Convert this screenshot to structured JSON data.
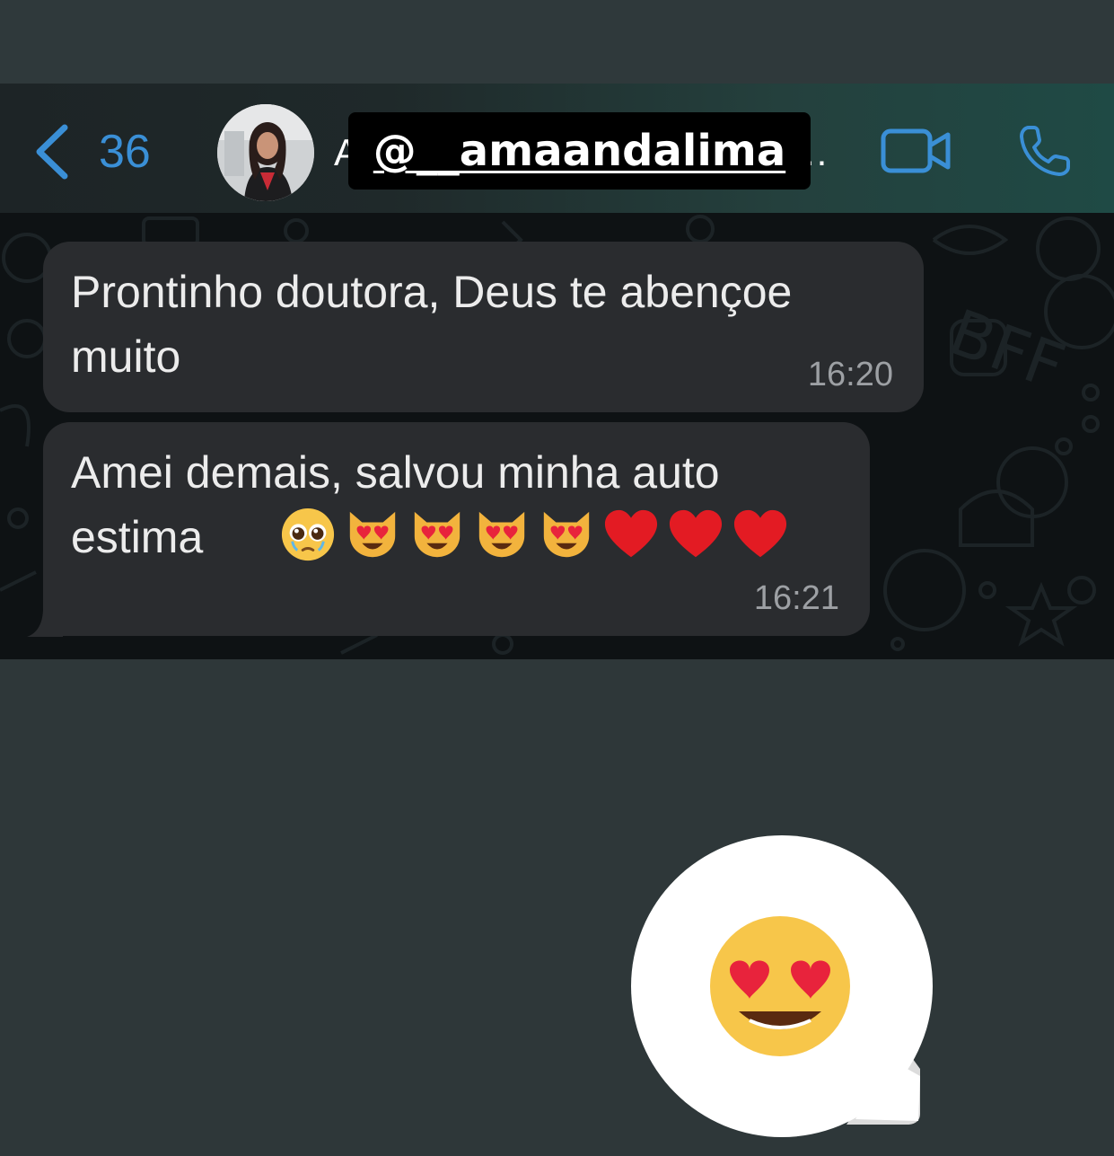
{
  "header": {
    "back_count": "36",
    "name_visible_start": "A",
    "name_ellipsis": "..",
    "handle_sticker": "@__amaandalima"
  },
  "messages": [
    {
      "text": "Prontinho doutora, Deus te abençoe\nmuito",
      "time": "16:20"
    },
    {
      "text": "Amei demais, salvou minha auto\nestima",
      "emojis": [
        "pleading-face",
        "heart-eyes-cat",
        "heart-eyes-cat",
        "heart-eyes-cat",
        "heart-eyes-cat",
        "red-heart",
        "red-heart",
        "red-heart"
      ],
      "time": "16:21"
    }
  ],
  "reaction_sticker": {
    "emoji": "smiling-face-with-heart-eyes"
  },
  "colors": {
    "accent_blue": "#3a8fd6",
    "bubble": "#2a2c2f",
    "chat_bg": "#0e1214",
    "page_bg": "#2e3739"
  }
}
